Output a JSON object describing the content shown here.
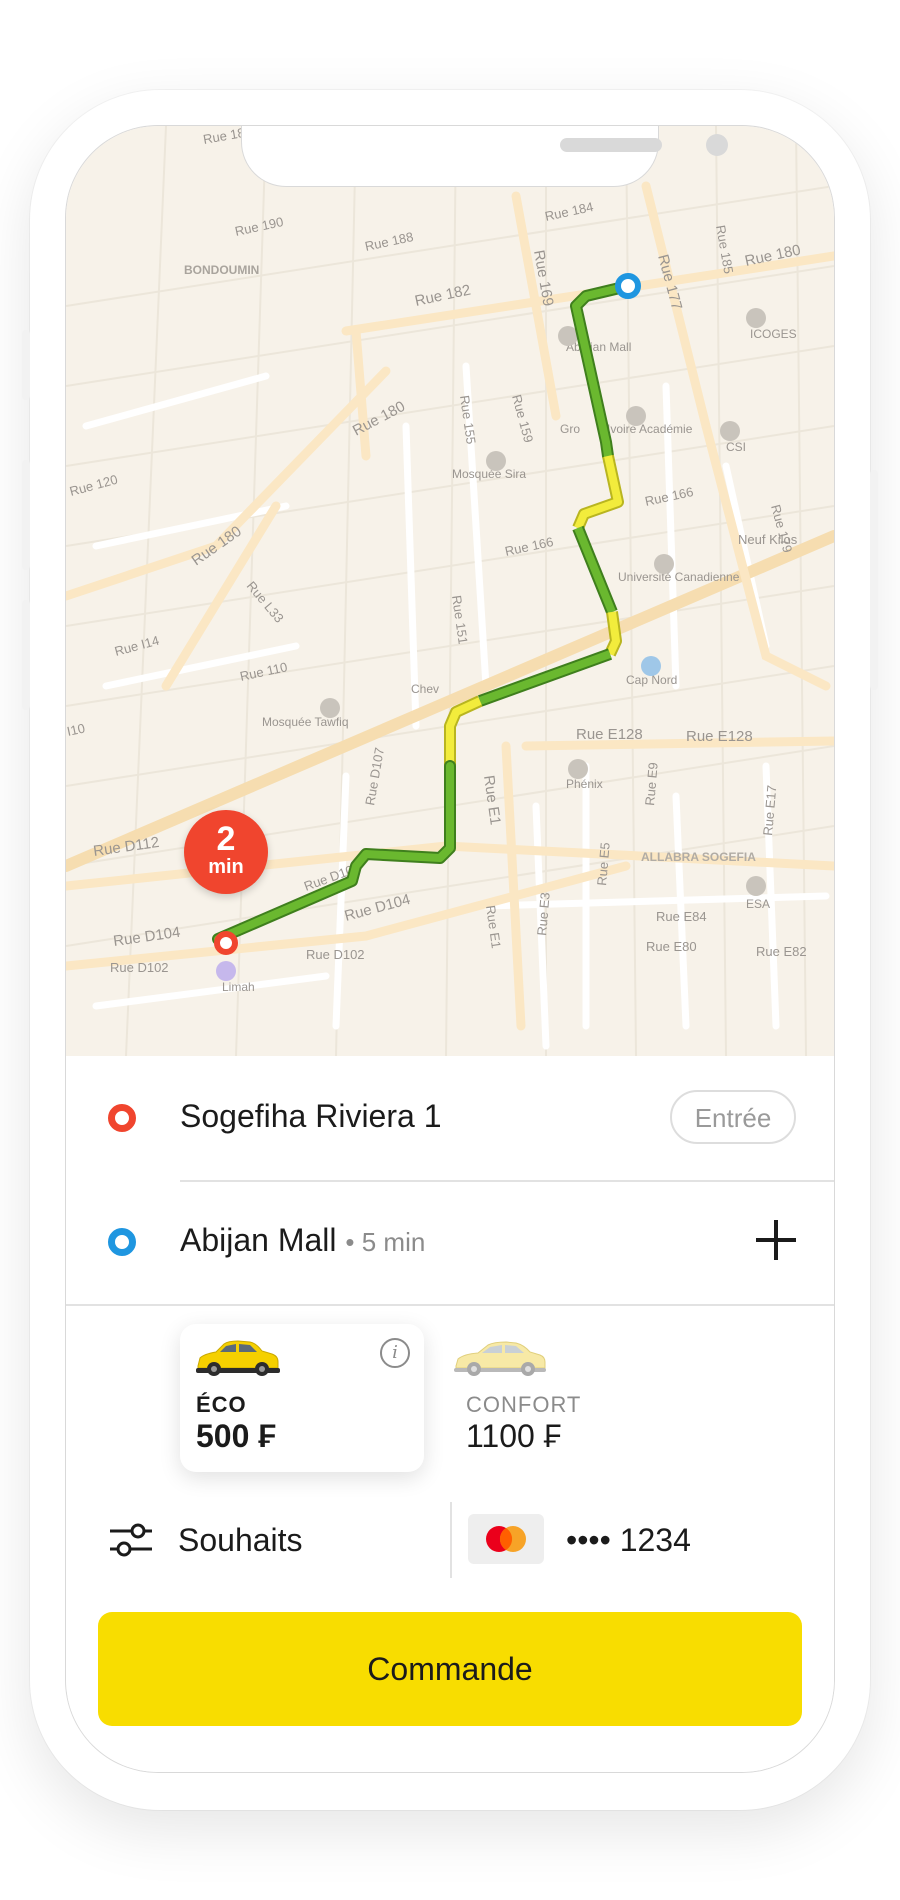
{
  "map": {
    "eta": {
      "value": "2",
      "unit": "min"
    },
    "street_labels": [
      "Rue 184",
      "Rue 190",
      "Rue 188",
      "Rue 182",
      "Rue 180",
      "Rue 169",
      "Rue 177",
      "Rue 185",
      "Rue 180",
      "Rue 155",
      "Rue 159",
      "Rue 166",
      "Rue 166",
      "Rue 120",
      "Rue 180",
      "Rue L33",
      "Rue 151",
      "Rue 179",
      "Rue I14",
      "Rue 110",
      "I10",
      "Rue E128",
      "Rue E128",
      "Rue D107",
      "Rue E1",
      "Rue E9",
      "Rue E17",
      "Rue D112",
      "Rue D106",
      "Rue D104",
      "Rue D104",
      "Rue D102",
      "Rue D102",
      "Rue E5",
      "Rue E3",
      "Rue E1",
      "Rue E84",
      "Rue E80",
      "Rue E82",
      "Rue 1"
    ],
    "places": [
      "BONDOUMIN",
      "Abidjan Mall",
      "ICOGES",
      "Ivoire Académie",
      "Gro",
      "CSI",
      "Mosquée Sira",
      "Neuf Kilos",
      "Université Canadienne",
      "Cap Nord",
      "Chev",
      "Mosquée Tawfiq",
      "Phénix",
      "ALLABRA SOGEFIA",
      "ESA",
      "Limah"
    ]
  },
  "route": {
    "origin": {
      "name": "Sogefiha Riviera 1",
      "entrance_button": "Entrée"
    },
    "destination": {
      "name": "Abijan Mall",
      "eta": "• 5 min"
    },
    "colors": {
      "origin": "#f0452e",
      "destination": "#1f96e0",
      "route_fast": "#6ab82f",
      "route_slow": "#f2ec3c"
    }
  },
  "tariffs": [
    {
      "name": "ÉCO",
      "price": "500 ₣",
      "selected": true
    },
    {
      "name": "CONFORT",
      "price": "1100 ₣",
      "selected": false
    }
  ],
  "options": {
    "wishes_label": "Souhaits",
    "card_number": "•••• 1234"
  },
  "order_button": {
    "label": "Commande",
    "color": "#f8dd00"
  }
}
